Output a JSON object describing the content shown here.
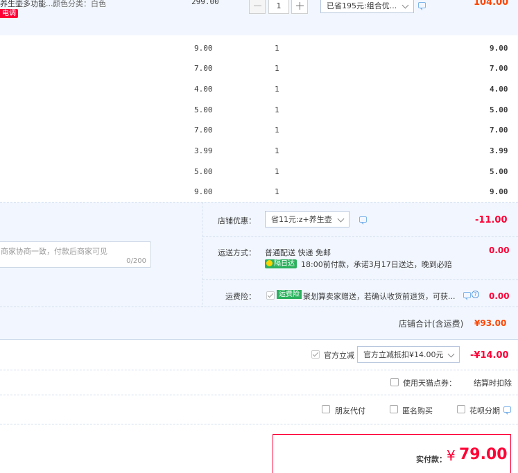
{
  "product": {
    "name": "养生壶多功能...",
    "sku": "颜色分类：白色",
    "badge": "电调",
    "price": "299.00",
    "qty": "1",
    "discount_select": "已省195元:组合优...",
    "subtotal": "104.00"
  },
  "items": [
    {
      "price": "9.00",
      "qty": "1",
      "subtotal": "9.00"
    },
    {
      "price": "7.00",
      "qty": "1",
      "subtotal": "7.00"
    },
    {
      "price": "4.00",
      "qty": "1",
      "subtotal": "4.00"
    },
    {
      "price": "5.00",
      "qty": "1",
      "subtotal": "5.00"
    },
    {
      "price": "7.00",
      "qty": "1",
      "subtotal": "7.00"
    },
    {
      "price": "3.99",
      "qty": "1",
      "subtotal": "3.99"
    },
    {
      "price": "5.00",
      "qty": "1",
      "subtotal": "5.00"
    },
    {
      "price": "9.00",
      "qty": "1",
      "subtotal": "9.00"
    }
  ],
  "store": {
    "promo_label": "店铺优惠：",
    "promo_select": "省11元:z+养生壶",
    "promo_amount": "-11.00",
    "message_placeholder": "商家协商一致，付款后商家可见",
    "message_count": "0/200",
    "shipping_label": "运送方式：",
    "shipping_method": "普通配送 快递 免邮",
    "shipping_tag": "隔日达",
    "shipping_note": "18:00前付款，承诺3月17日送达，晚到必赔",
    "shipping_amount": "0.00",
    "insurance_label": "运费险：",
    "insurance_tag": "运费险",
    "insurance_text": "聚划算卖家赠送，若确认收货前退货，可获...",
    "insurance_amount": "0.00",
    "total_label": "店铺合计(含运费)",
    "total_amount": "¥93.00"
  },
  "official": {
    "label": "官方立减",
    "select": "官方立减抵扣¥14.00元",
    "amount": "-¥14.00"
  },
  "points": {
    "label": "使用天猫点券：",
    "note": "结算时扣除"
  },
  "options": {
    "friend_pay": "朋友代付",
    "anonymous": "匿名购买",
    "huabei": "花呗分期"
  },
  "pay": {
    "label": "实付款：",
    "currency": "¥",
    "amount": "79.00"
  },
  "colors": {
    "accent": "#ff0036",
    "orange": "#ff4400",
    "panel": "#f2f7ff"
  }
}
